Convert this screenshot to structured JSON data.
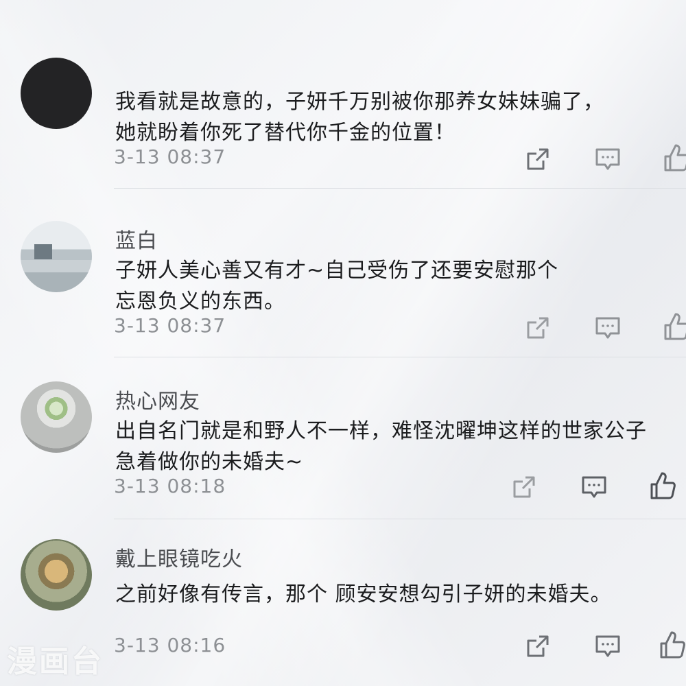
{
  "comments": [
    {
      "username": "",
      "line1": "我看就是故意的，子妍千万别被你那养女妹妹骗了，",
      "line2": "她就盼着你死了替代你千金的位置！",
      "time": "3-13 08:37"
    },
    {
      "username": "蓝白",
      "line1": "子妍人美心善又有才~自己受伤了还要安慰那个",
      "line2": "忘恩负义的东西。",
      "time": "3-13 08:37"
    },
    {
      "username": "热心网友",
      "line1": "出自名门就是和野人不一样，难怪沈曜坤这样的世家公子",
      "line2": "急着做你的未婚夫~",
      "time": "3-13 08:18"
    },
    {
      "username": "戴上眼镜吃火",
      "line1": "之前好像有传言，那个 顾安安想勾引子妍的未婚夫。",
      "line2": "",
      "time": "3-13 08:16"
    }
  ],
  "icons": {
    "share": "share-icon",
    "comment": "comment-icon",
    "like": "thumbs-up-icon"
  },
  "watermark": "漫画台",
  "colors": {
    "text": "#1b1c1e",
    "username": "#4a4c50",
    "timestamp": "#8d9094",
    "icon": "#8f9296"
  }
}
